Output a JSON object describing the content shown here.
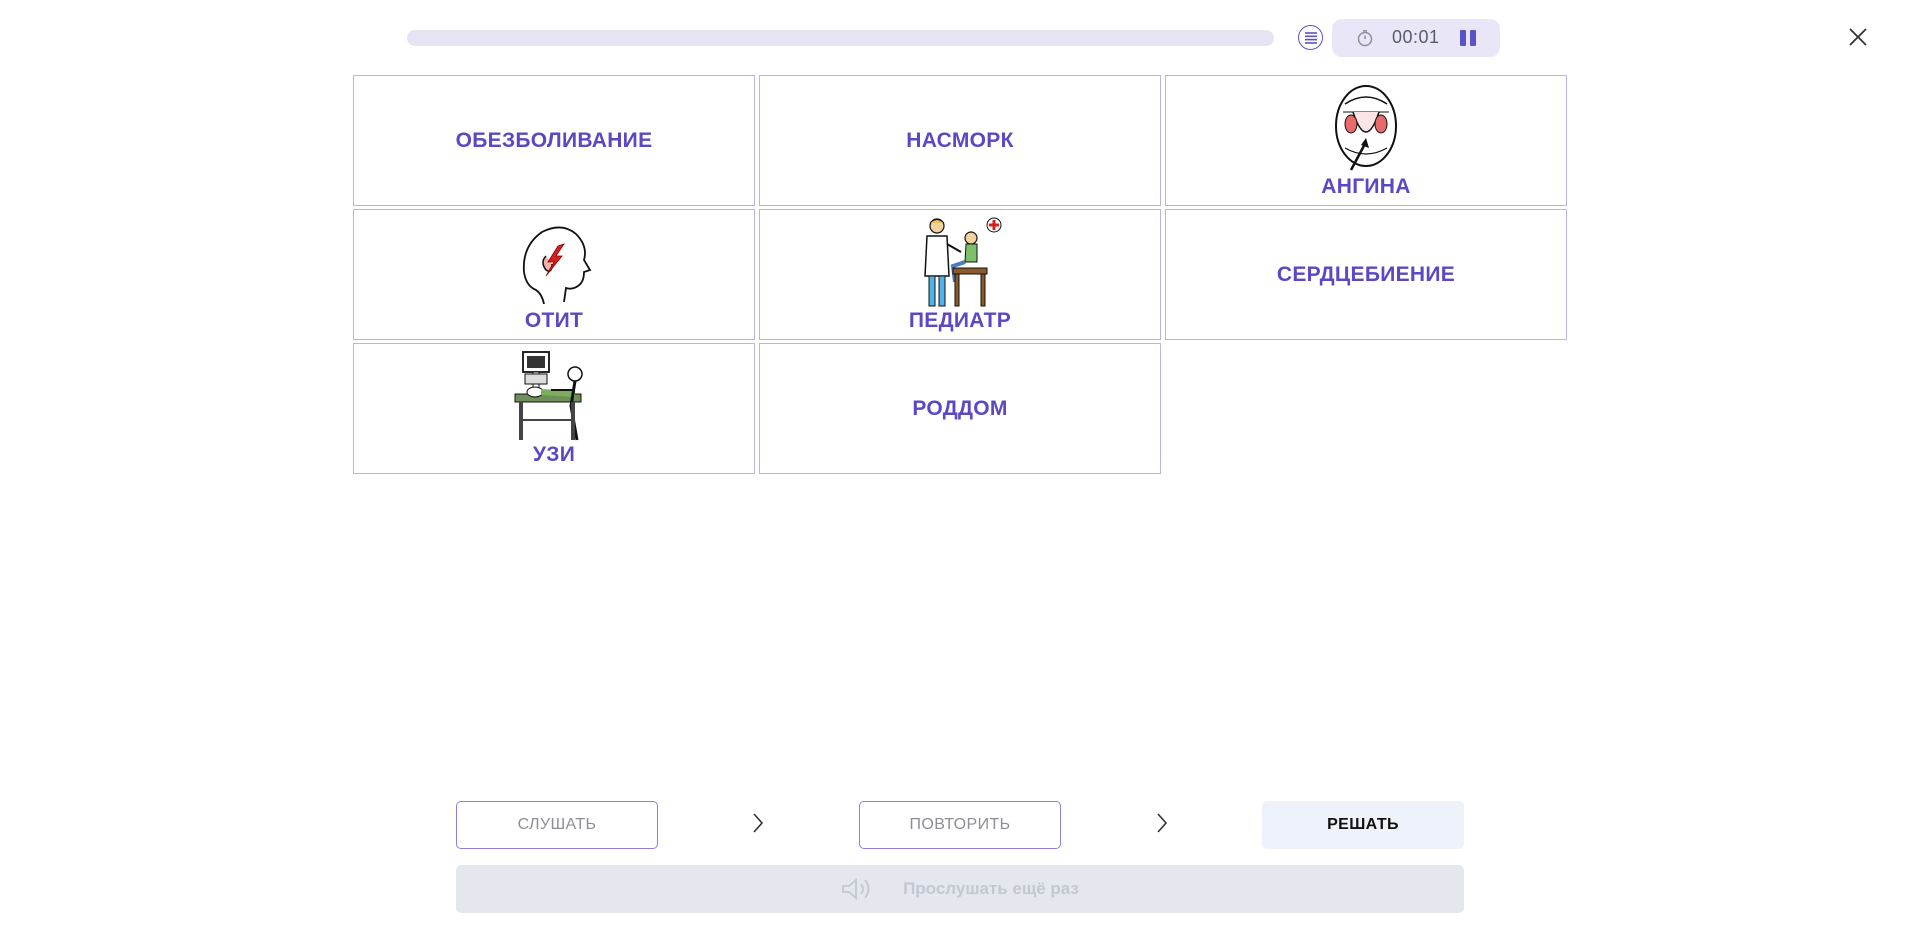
{
  "header": {
    "progress_fraction": 0.0,
    "timer": "00:01"
  },
  "cards": [
    {
      "label": "ОБЕЗБОЛИВАНИЕ",
      "image": null
    },
    {
      "label": "НАСМОРК",
      "image": null
    },
    {
      "label": "АНГИНА",
      "image": "throat-illustration"
    },
    {
      "label": "ОТИТ",
      "image": "ear-pain-illustration"
    },
    {
      "label": "ПЕДИАТР",
      "image": "pediatrician-illustration"
    },
    {
      "label": "СЕРДЦЕБИЕНИЕ",
      "image": null
    },
    {
      "label": "УЗИ",
      "image": "ultrasound-illustration"
    },
    {
      "label": "РОДДОМ",
      "image": null
    }
  ],
  "actions": {
    "listen": "СЛУШАТЬ",
    "repeat": "ПОВТОРИТЬ",
    "solve": "РЕШАТЬ",
    "listen_again": "Прослушать ещё раз"
  },
  "colors": {
    "accent": "#5b48c2",
    "card_border": "#b9b4e4",
    "timer_bg": "#e9e6f8"
  }
}
